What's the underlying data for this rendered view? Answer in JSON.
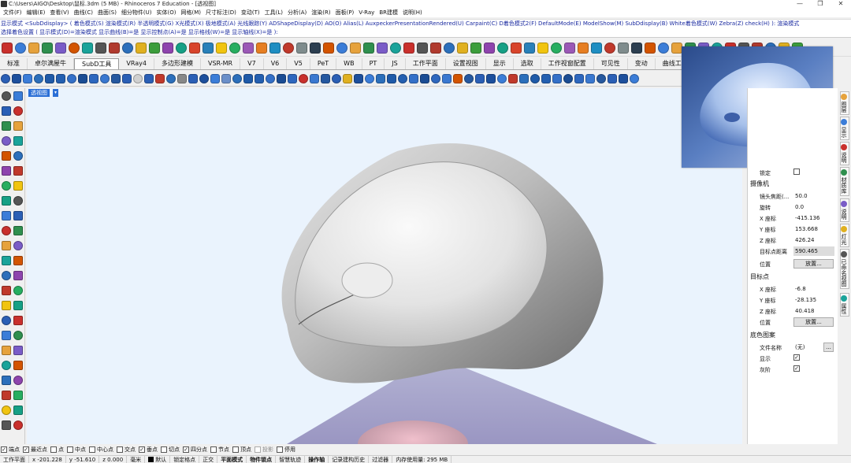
{
  "window": {
    "title": "C:\\Users\\AIGO\\Desktop\\鼠标.3dm (5 MB) - Rhinoceros 7 Education - [透视图]",
    "controls": [
      "—",
      "❐",
      "✕"
    ]
  },
  "menu": {
    "items": [
      "文件(F)",
      "编辑(E)",
      "查看(V)",
      "曲线(C)",
      "曲面(S)",
      "细分物件(U)",
      "实体(O)",
      "网格(M)",
      "尺寸标注(D)",
      "变动(T)",
      "工具(L)",
      "分析(A)",
      "渲染(R)",
      "面板(P)",
      "V-Ray",
      "BR建模",
      "说明(H)"
    ]
  },
  "command_history": {
    "line1": "显示模式 <SubDdisplay> ( 着色模式(S)  渲染模式(R)  半透明模式(G)  X光模式(X)  极地模式(A)  光线跟踪(Y)  ADShapeDisplay(D)  AO(O)  Alias(L)  AuxpeckerPresentationRendered(U)  Carpaint(C)  D着色模式2(F)  DefaultMode(E)  ModelShow(M)  SubDdisplay(B)  White着色模式(W)  Zebra(Z)  check(H) ): 渲染模式",
    "line2": "选择着色设置 ( 显示模式(D)=渲染模式  显示曲线(B)=是  显示控制点(A)=是  显示格线(W)=是  显示轴线(X)=是 ):"
  },
  "tabs": [
    {
      "label": "标准",
      "active": false
    },
    {
      "label": "卓尔满屋牛",
      "active": false
    },
    {
      "label": "SubD工具",
      "active": true
    },
    {
      "label": "VRay4",
      "active": false
    },
    {
      "label": "多边形建模",
      "active": false
    },
    {
      "label": "VSR-MR",
      "active": false
    },
    {
      "label": "V7",
      "active": false
    },
    {
      "label": "V6",
      "active": false
    },
    {
      "label": "V5",
      "active": false
    },
    {
      "label": "PeT",
      "active": false
    },
    {
      "label": "WB",
      "active": false
    },
    {
      "label": "PT",
      "active": false
    },
    {
      "label": "JS",
      "active": false
    },
    {
      "label": "工作平面",
      "active": false
    },
    {
      "label": "设置视图",
      "active": false
    },
    {
      "label": "显示",
      "active": false
    },
    {
      "label": "选取",
      "active": false
    },
    {
      "label": "工作视窗配置",
      "active": false
    },
    {
      "label": "可见性",
      "active": false
    },
    {
      "label": "变动",
      "active": false
    },
    {
      "label": "曲线工",
      "active": false
    }
  ],
  "viewport": {
    "label": "透视图",
    "menu_glyph": "▾"
  },
  "properties": {
    "lock_label": "锁定",
    "camera_section": "摄像机",
    "camera_rows": [
      {
        "key": "镜头焦距(...",
        "value": "50.0",
        "highlight": false
      },
      {
        "key": "旋转",
        "value": "0.0",
        "highlight": false
      },
      {
        "key": "X 座标",
        "value": "-415.136",
        "highlight": false
      },
      {
        "key": "Y 座标",
        "value": "153.668",
        "highlight": false
      },
      {
        "key": "Z 座标",
        "value": "426.24",
        "highlight": false
      },
      {
        "key": "目标点距离",
        "value": "590.465",
        "highlight": true
      }
    ],
    "position_label": "位置",
    "place_button": "放置...",
    "target_section": "目标点",
    "target_rows": [
      {
        "key": "X 座标",
        "value": "-6.8"
      },
      {
        "key": "Y 座标",
        "value": "-28.135"
      },
      {
        "key": "Z 座标",
        "value": "40.418"
      }
    ],
    "target_position_label": "位置",
    "target_place_button": "放置...",
    "bg_section": "底色图案",
    "filename_label": "文件名称",
    "filename_value": "(无)",
    "browse_button": "...",
    "show_label": "显示",
    "gray_label": "灰阶"
  },
  "right_tabs": [
    "图层",
    "显示",
    "说明",
    "材质库",
    "说明",
    "灯光",
    "已命名视图",
    "属性"
  ],
  "osnap": [
    {
      "label": "端点",
      "checked": true,
      "disabled": false
    },
    {
      "label": "最近点",
      "checked": true,
      "disabled": false
    },
    {
      "label": "点",
      "checked": false,
      "disabled": false
    },
    {
      "label": "中点",
      "checked": false,
      "disabled": false
    },
    {
      "label": "中心点",
      "checked": false,
      "disabled": false
    },
    {
      "label": "交点",
      "checked": false,
      "disabled": false
    },
    {
      "label": "垂点",
      "checked": true,
      "disabled": false
    },
    {
      "label": "切点",
      "checked": false,
      "disabled": false
    },
    {
      "label": "四分点",
      "checked": true,
      "disabled": false
    },
    {
      "label": "节点",
      "checked": false,
      "disabled": false
    },
    {
      "label": "顶点",
      "checked": false,
      "disabled": false
    },
    {
      "label": "投影",
      "checked": false,
      "disabled": true
    },
    {
      "label": "停用",
      "checked": false,
      "disabled": false
    }
  ],
  "status": {
    "cplane": "工作平面",
    "x": "x -201.228",
    "y": "y -51.610",
    "z": "z 0.000",
    "unit": "毫米",
    "layer": "默认",
    "items": [
      "锁定格点",
      "正交",
      "平面模式",
      "物件锁点",
      "智慧轨迹",
      "操作轴",
      "记录建构历史",
      "过滤器",
      "内存使用量: 295 MB"
    ],
    "bold_items": [
      "平面模式",
      "物件锁点",
      "操作轴"
    ]
  },
  "icons": {
    "standard_colors": [
      "#c9302c",
      "#3b7dd8",
      "#e6a23c",
      "#2f8f4e",
      "#7a5cc7",
      "#d35400",
      "#1aa39a",
      "#555555",
      "#b03a2e",
      "#2c6fbb",
      "#e0b020",
      "#3c9d3c",
      "#8e44ad",
      "#16a085",
      "#d8442b",
      "#2980b9",
      "#f1c40f",
      "#27ae60",
      "#9b59b6",
      "#e67e22",
      "#1f8ec2",
      "#c0392b",
      "#7f8c8d",
      "#2c3e50",
      "#d35400",
      "#3b7dd8",
      "#e6a23c",
      "#2f8f4e",
      "#7a5cc7",
      "#1aa39a",
      "#c9302c",
      "#555555",
      "#b03a2e",
      "#2c6fbb",
      "#e0b020",
      "#3c9d3c",
      "#8e44ad",
      "#16a085",
      "#d8442b",
      "#2980b9",
      "#f1c40f",
      "#27ae60",
      "#9b59b6",
      "#e67e22",
      "#1f8ec2",
      "#c0392b",
      "#7f8c8d",
      "#2c3e50",
      "#d35400",
      "#3b7dd8",
      "#e6a23c",
      "#2f8f4e",
      "#7a5cc7",
      "#1aa39a",
      "#c9302c",
      "#555555",
      "#b03a2e",
      "#2c6fbb",
      "#e0b020",
      "#3c9d3c"
    ],
    "subd_colors": [
      "#2b5fb5",
      "#1d4f9c",
      "#3b7dd8",
      "#2c6fbb",
      "#1f5aa8",
      "#245fb0",
      "#3470c8",
      "#1b4c93",
      "#2e67be",
      "#3a78d0",
      "#26589f",
      "#2b5fb5",
      "#d0d0d0",
      "#2b5fb5",
      "#c0392b",
      "#2c6fbb",
      "#888888",
      "#2b5fb5",
      "#1d4f9c",
      "#3b7dd8",
      "#6b8fc9",
      "#2c6fbb",
      "#1f5aa8",
      "#245fb0",
      "#3470c8",
      "#1b4c93",
      "#2e67be",
      "#c9302c",
      "#3a78d0",
      "#26589f",
      "#2b5fb5",
      "#e0b020",
      "#1d4f9c",
      "#3b7dd8",
      "#2c6fbb",
      "#1f5aa8",
      "#245fb0",
      "#3470c8",
      "#1b4c93",
      "#2e67be",
      "#3a78d0",
      "#d35400",
      "#26589f",
      "#2b5fb5",
      "#1d4f9c",
      "#3b7dd8",
      "#c0392b",
      "#2c6fbb",
      "#1f5aa8",
      "#245fb0",
      "#3470c8",
      "#1b4c93",
      "#2e67be",
      "#3a78d0",
      "#26589f",
      "#2b5fb5",
      "#1d4f9c",
      "#3b7dd8"
    ],
    "left_colors": [
      "#555555",
      "#3b7dd8",
      "#2b5fb5",
      "#c9302c",
      "#2f8f4e",
      "#e6a23c",
      "#7a5cc7",
      "#1aa39a",
      "#d35400",
      "#2c6fbb",
      "#8e44ad",
      "#c0392b",
      "#27ae60",
      "#f1c40f",
      "#16a085",
      "#555555",
      "#3b7dd8",
      "#2b5fb5",
      "#c9302c",
      "#2f8f4e",
      "#e6a23c",
      "#7a5cc7",
      "#1aa39a",
      "#d35400",
      "#2c6fbb",
      "#8e44ad",
      "#c0392b",
      "#27ae60",
      "#f1c40f",
      "#16a085",
      "#2b5fb5",
      "#c9302c",
      "#3b7dd8",
      "#2f8f4e",
      "#e6a23c",
      "#7a5cc7",
      "#1aa39a",
      "#d35400",
      "#2c6fbb",
      "#8e44ad",
      "#c0392b",
      "#27ae60",
      "#f1c40f",
      "#16a085",
      "#555555",
      "#c9302c"
    ]
  },
  "colors": {
    "viewport_bg": "#eaf3fd",
    "viewport_label_bg": "#2b6fd6",
    "accent": "#2b6fd6"
  }
}
